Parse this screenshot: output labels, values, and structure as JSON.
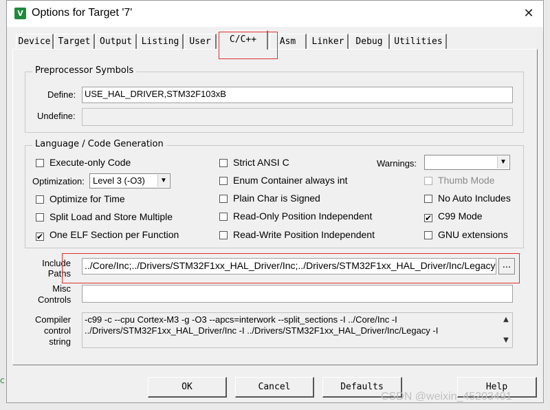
{
  "window": {
    "title": "Options for Target '7'",
    "app_icon": "V"
  },
  "tabs": [
    "Device",
    "Target",
    "Output",
    "Listing",
    "User",
    "C/C++",
    "Asm",
    "Linker",
    "Debug",
    "Utilities"
  ],
  "active_tab": "C/C++",
  "preprocessor": {
    "group_label": "Preprocessor Symbols",
    "define_label": "Define:",
    "define_value": "USE_HAL_DRIVER,STM32F103xB",
    "undefine_label": "Undefine:",
    "undefine_value": ""
  },
  "language": {
    "group_label": "Language / Code Generation",
    "execute_only": "Execute-only Code",
    "optimization_label": "Optimization:",
    "optimization_value": "Level 3 (-O3)",
    "optimize_time": "Optimize for Time",
    "split_load": "Split Load and Store Multiple",
    "one_elf": "One ELF Section per Function",
    "strict_ansi": "Strict ANSI C",
    "enum_container": "Enum Container always int",
    "plain_char": "Plain Char is Signed",
    "ro_pos": "Read-Only Position Independent",
    "rw_pos": "Read-Write Position Independent",
    "warnings_label": "Warnings:",
    "warnings_value": "",
    "thumb_mode": "Thumb Mode",
    "no_auto_includes": "No Auto Includes",
    "c99_mode": "C99 Mode",
    "gnu_ext": "GNU extensions",
    "checked_mark": "✔"
  },
  "include": {
    "label_line1": "Include",
    "label_line2": "Paths",
    "value": "../Core/Inc;../Drivers/STM32F1xx_HAL_Driver/Inc;../Drivers/STM32F1xx_HAL_Driver/Inc/Legacy;",
    "browse": "..."
  },
  "misc": {
    "label_line1": "Misc",
    "label_line2": "Controls",
    "value": ""
  },
  "compiler": {
    "label_line1": "Compiler",
    "label_line2": "control",
    "label_line3": "string",
    "line1": "-c99 -c --cpu Cortex-M3 -g -O3 --apcs=interwork --split_sections -I ../Core/Inc -I",
    "line2": "../Drivers/STM32F1xx_HAL_Driver/Inc -I ../Drivers/STM32F1xx_HAL_Driver/Inc/Legacy -I"
  },
  "buttons": {
    "ok": "OK",
    "cancel": "Cancel",
    "defaults": "Defaults",
    "help": "Help"
  },
  "watermark": "CSDN @weixin_45203491",
  "colors": {
    "highlight": "#e03030",
    "app_icon": "#1e8a3a"
  }
}
